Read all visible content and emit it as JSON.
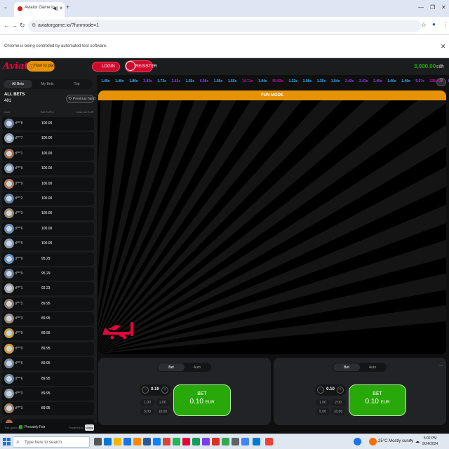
{
  "browser": {
    "tab_title": "Aviator Game.io",
    "url": "aviatorgame.io/?funmode=1",
    "automation_notice": "Chrome is being controlled by automated test software.",
    "icons": [
      "chevron-down-icon",
      "mute-icon",
      "close-icon",
      "plus-icon",
      "back-icon",
      "forward-icon",
      "reload-icon",
      "star-icon",
      "profile-icon",
      "menu-icon"
    ]
  },
  "header": {
    "logo": "Aviator",
    "how_to_play": "How to play",
    "login": "LOGIN",
    "register": "REGISTER",
    "balance": "3,000.00",
    "currency": "EUR",
    "brand_red": "#e50539",
    "accent_orange": "#e69308",
    "balance_green": "#28a909"
  },
  "sidebar": {
    "tabs": [
      "All Bets",
      "My Bets",
      "Top"
    ],
    "active_tab": "All Bets",
    "all_bets_label": "ALL BETS",
    "all_bets_count": "481",
    "previous_hand": "Previous hand",
    "columns": [
      "User",
      "Bet EUR",
      "X",
      "Cash out EUR"
    ],
    "bets": [
      {
        "user": "d***8",
        "bet": "100.00"
      },
      {
        "user": "d***7",
        "bet": "100.00"
      },
      {
        "user": "d***1",
        "bet": "100.00"
      },
      {
        "user": "d***9",
        "bet": "100.00"
      },
      {
        "user": "d***9",
        "bet": "100.00"
      },
      {
        "user": "d***2",
        "bet": "100.00"
      },
      {
        "user": "d***3",
        "bet": "100.00"
      },
      {
        "user": "d***6",
        "bet": "100.00"
      },
      {
        "user": "d***5",
        "bet": "100.00"
      },
      {
        "user": "d***9",
        "bet": "95.29"
      },
      {
        "user": "d***9",
        "bet": "95.29"
      },
      {
        "user": "d***1",
        "bet": "92.23"
      },
      {
        "user": "d***3",
        "bet": "89.95"
      },
      {
        "user": "d***3",
        "bet": "89.95"
      },
      {
        "user": "d***9",
        "bet": "89.95"
      },
      {
        "user": "d***9",
        "bet": "89.95"
      },
      {
        "user": "d***6",
        "bet": "89.95"
      },
      {
        "user": "d***6",
        "bet": "89.95"
      },
      {
        "user": "d***3",
        "bet": "89.95"
      },
      {
        "user": "d***3",
        "bet": "89.95"
      }
    ],
    "footer_text": "This game is",
    "provably_fair": "Provably Fair",
    "powered_by": "Powered by",
    "provider": "SPRIBE"
  },
  "history": [
    {
      "value": "1.45x",
      "color": "#34b4ff"
    },
    {
      "value": "1.40x",
      "color": "#34b4ff"
    },
    {
      "value": "1.80x",
      "color": "#34b4ff"
    },
    {
      "value": "3.83x",
      "color": "#913ef8"
    },
    {
      "value": "1.73x",
      "color": "#34b4ff"
    },
    {
      "value": "2.63x",
      "color": "#913ef8"
    },
    {
      "value": "1.55x",
      "color": "#34b4ff"
    },
    {
      "value": "6.98x",
      "color": "#913ef8"
    },
    {
      "value": "1.56x",
      "color": "#34b4ff"
    },
    {
      "value": "1.55x",
      "color": "#34b4ff"
    },
    {
      "value": "14.71x",
      "color": "#c017b4"
    },
    {
      "value": "1.04x",
      "color": "#34b4ff"
    },
    {
      "value": "95.92x",
      "color": "#c017b4"
    },
    {
      "value": "1.22x",
      "color": "#34b4ff"
    },
    {
      "value": "1.08x",
      "color": "#34b4ff"
    },
    {
      "value": "1.30x",
      "color": "#34b4ff"
    },
    {
      "value": "1.04x",
      "color": "#34b4ff"
    },
    {
      "value": "2.42x",
      "color": "#913ef8"
    },
    {
      "value": "2.43x",
      "color": "#913ef8"
    },
    {
      "value": "2.49x",
      "color": "#913ef8"
    },
    {
      "value": "1.00x",
      "color": "#34b4ff"
    },
    {
      "value": "1.49x",
      "color": "#34b4ff"
    },
    {
      "value": "5.57x",
      "color": "#913ef8"
    },
    {
      "value": "128.60x",
      "color": "#c017b4"
    },
    {
      "value": "8.37x",
      "color": "#913ef8"
    },
    {
      "value": "3.19x",
      "color": "#913ef8"
    },
    {
      "value": "2.85x",
      "color": "#913ef8"
    }
  ],
  "game": {
    "fun_mode": "FUN MODE"
  },
  "bet_panels": [
    {
      "tabs": [
        "Bet",
        "Auto"
      ],
      "active_tab": "Bet",
      "stake": "0.10",
      "quick": [
        "1.00",
        "2.00",
        "5.00",
        "10.00"
      ],
      "button_label": "BET",
      "button_amount": "0.10",
      "button_currency": "EUR"
    },
    {
      "tabs": [
        "Bet",
        "Auto"
      ],
      "active_tab": "Bet",
      "stake": "0.10",
      "quick": [
        "1.00",
        "2.00",
        "5.00",
        "10.00"
      ],
      "button_label": "BET",
      "button_amount": "0.10",
      "button_currency": "EUR"
    }
  ],
  "taskbar": {
    "search_placeholder": "Type here to search",
    "weather": "25°C  Mostly sunny",
    "time": "5:02 PM",
    "date": "9/24/2024"
  }
}
